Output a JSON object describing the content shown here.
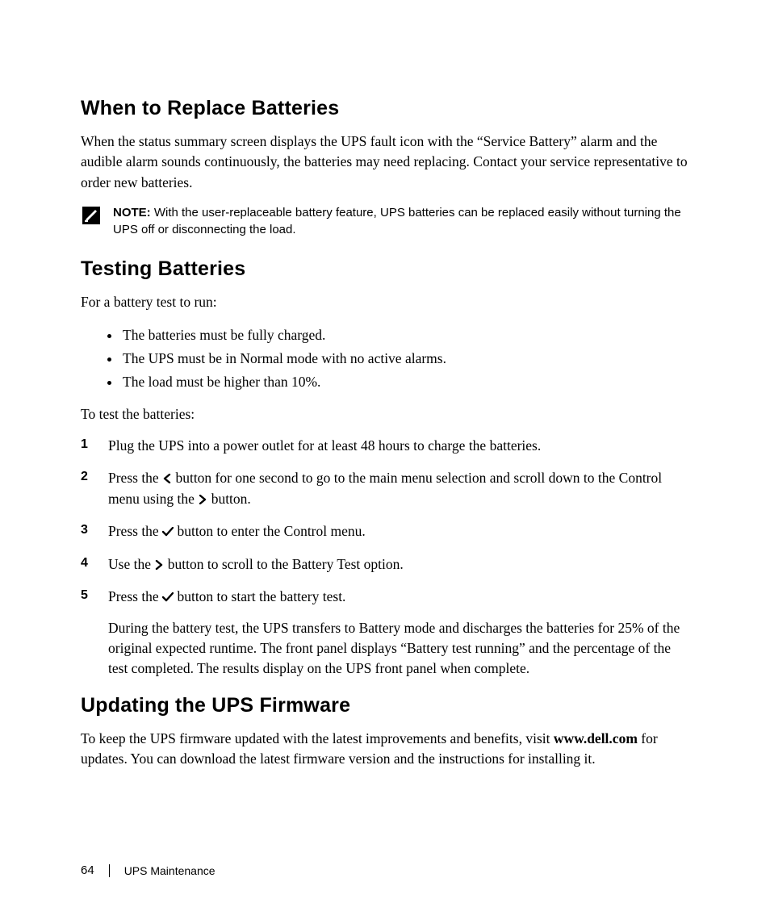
{
  "sections": {
    "replace": {
      "heading": "When to Replace Batteries",
      "para": "When the status summary screen displays the UPS fault icon with the “Service Battery” alarm and the audible alarm sounds continuously, the batteries may need replacing. Contact your service representative to order new batteries."
    },
    "note": {
      "label": "NOTE:",
      "text": " With the user-replaceable battery feature, UPS batteries can be replaced easily without turning the UPS off or disconnecting the load."
    },
    "testing": {
      "heading": "Testing Batteries",
      "intro": "For a battery test to run:",
      "bullets": [
        "The batteries must be fully charged.",
        "The UPS must be in Normal mode with no active alarms.",
        "The load must be higher than 10%."
      ],
      "lead": "To test the batteries:",
      "steps": [
        {
          "n": "1",
          "body": [
            "Plug the UPS into a power outlet for at least 48 hours to charge the batteries."
          ]
        },
        {
          "n": "2",
          "pre": "Press the ",
          "mid": " button for one second to go to the main menu selection and scroll down to the Control menu using the ",
          "post": " button.",
          "icon1": "left",
          "icon2": "right"
        },
        {
          "n": "3",
          "pre": "Press the ",
          "post": " button to enter the Control menu.",
          "icon1": "check"
        },
        {
          "n": "4",
          "pre": "Use the ",
          "post": " button to scroll to the Battery Test option.",
          "icon1": "right"
        },
        {
          "n": "5",
          "pre": "Press the ",
          "post": " button to start the battery test.",
          "icon1": "check",
          "after": "During the battery test, the UPS transfers to Battery mode and discharges the batteries for 25% of the original expected runtime. The front panel displays “Battery test running” and the percentage of the test completed. The results display on the UPS front panel when complete."
        }
      ]
    },
    "firmware": {
      "heading": "Updating the UPS Firmware",
      "para_pre": "To keep the UPS firmware updated with the latest improvements and benefits, visit ",
      "site": "www.dell.com",
      "para_post": " for updates. You can download the latest firmware version and the instructions for installing it."
    }
  },
  "footer": {
    "page": "64",
    "section": "UPS Maintenance"
  }
}
